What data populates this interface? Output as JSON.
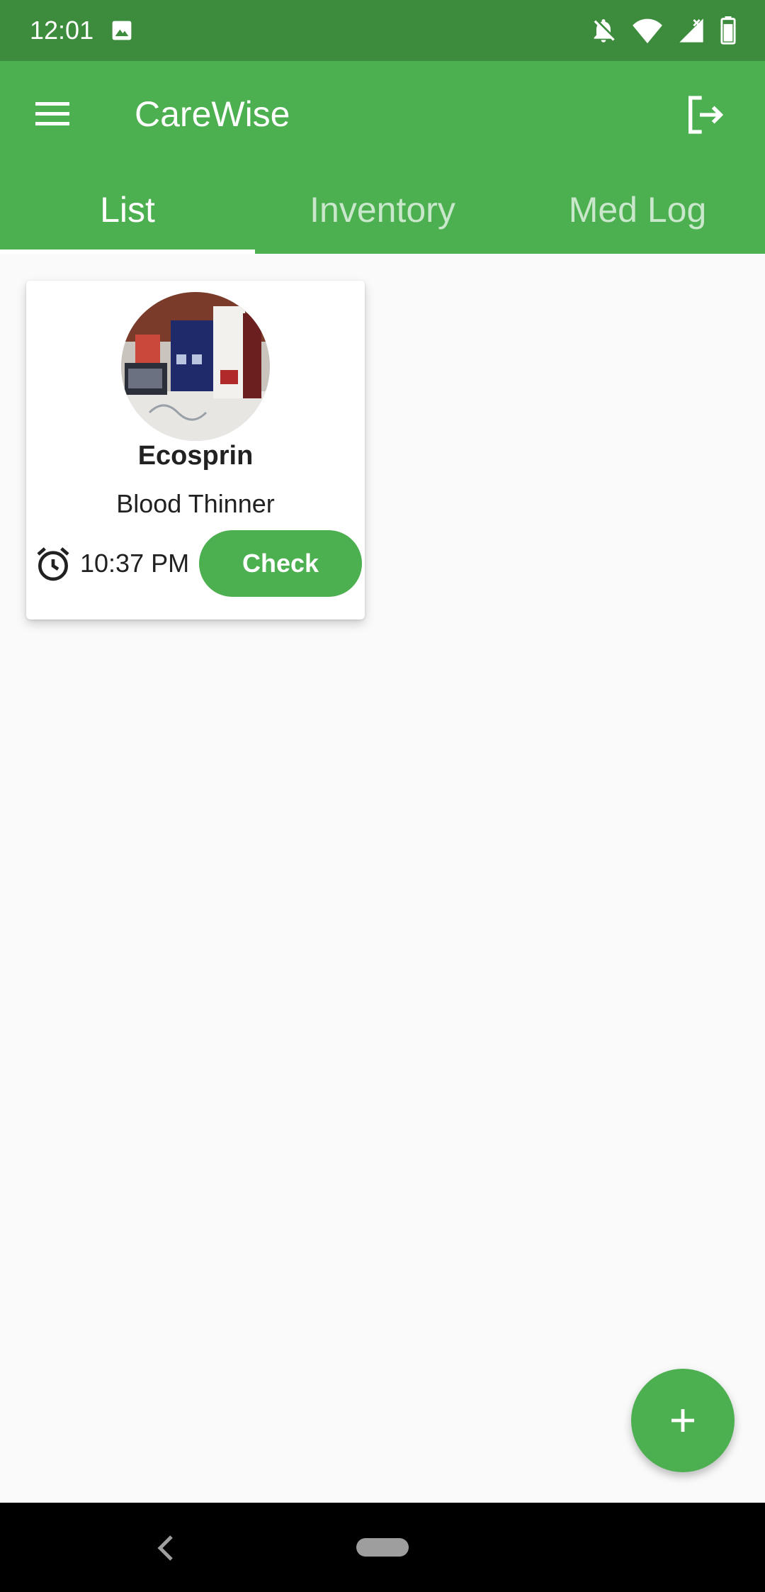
{
  "status_bar": {
    "time": "12:01"
  },
  "app_bar": {
    "title": "CareWise"
  },
  "tabs": [
    {
      "label": "List",
      "active": true
    },
    {
      "label": "Inventory",
      "active": false
    },
    {
      "label": "Med Log",
      "active": false
    }
  ],
  "medication_card": {
    "name": "Ecosprin",
    "type": "Blood Thinner",
    "time": "10:37 PM",
    "check_label": "Check"
  },
  "colors": {
    "primary": "#4caf50",
    "primary_dark": "#3d8b3d",
    "background": "#fafafa"
  }
}
